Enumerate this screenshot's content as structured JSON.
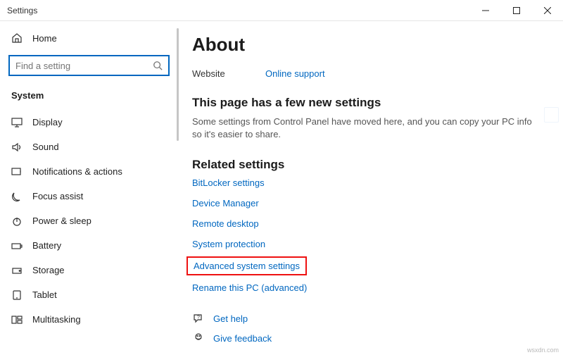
{
  "window": {
    "title": "Settings"
  },
  "home_label": "Home",
  "search": {
    "placeholder": "Find a setting"
  },
  "category": "System",
  "nav": [
    {
      "label": "Display"
    },
    {
      "label": "Sound"
    },
    {
      "label": "Notifications & actions"
    },
    {
      "label": "Focus assist"
    },
    {
      "label": "Power & sleep"
    },
    {
      "label": "Battery"
    },
    {
      "label": "Storage"
    },
    {
      "label": "Tablet"
    },
    {
      "label": "Multitasking"
    }
  ],
  "page_title": "About",
  "website": {
    "label": "Website",
    "value": "Online support"
  },
  "new_settings": {
    "heading": "This page has a few new settings",
    "subtext": "Some settings from Control Panel have moved here, and you can copy your PC info so it's easier to share."
  },
  "related": {
    "heading": "Related settings",
    "links": [
      "BitLocker settings",
      "Device Manager",
      "Remote desktop",
      "System protection",
      "Advanced system settings",
      "Rename this PC (advanced)"
    ],
    "highlighted_index": 4
  },
  "help": {
    "get_help": "Get help",
    "give_feedback": "Give feedback"
  },
  "watermark": "wsxdn.com"
}
